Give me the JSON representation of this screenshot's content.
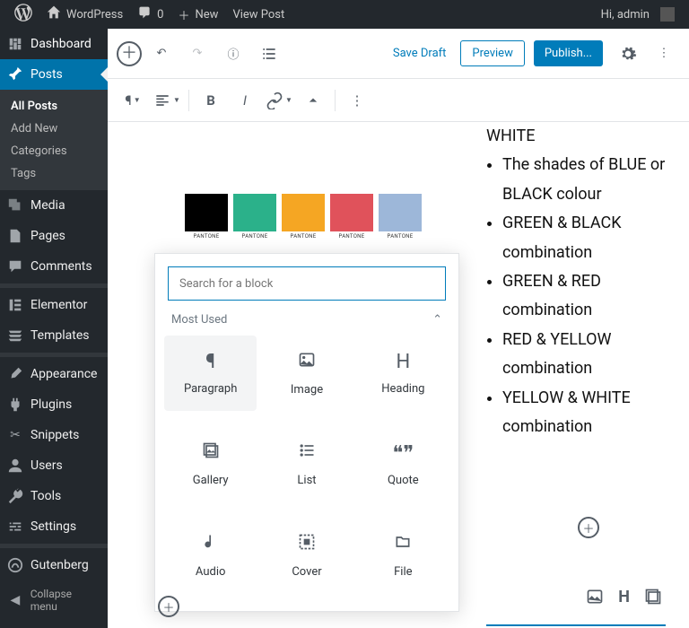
{
  "adminbar": {
    "site": "WordPress",
    "comments": "0",
    "new": "New",
    "view": "View Post",
    "greeting": "Hi, admin"
  },
  "sidebar": {
    "dashboard": "Dashboard",
    "posts": "Posts",
    "posts_sub": [
      "All Posts",
      "Add New",
      "Categories",
      "Tags"
    ],
    "media": "Media",
    "pages": "Pages",
    "comments": "Comments",
    "elementor": "Elementor",
    "templates": "Templates",
    "appearance": "Appearance",
    "plugins": "Plugins",
    "snippets": "Snippets",
    "users": "Users",
    "tools": "Tools",
    "settings": "Settings",
    "gutenberg": "Gutenberg",
    "collapse": "Collapse menu"
  },
  "editor": {
    "save_draft": "Save Draft",
    "preview": "Preview",
    "publish": "Publish..."
  },
  "swatches": [
    {
      "color": "#000000",
      "label": "PANTONE"
    },
    {
      "color": "#2bb18a",
      "label": "PANTONE"
    },
    {
      "color": "#f5a623",
      "label": "PANTONE"
    },
    {
      "color": "#e0525b",
      "label": "PANTONE"
    },
    {
      "color": "#9db7d9",
      "label": "PANTONE"
    }
  ],
  "list_items": [
    "WHITE",
    "The  shades of BLUE or BLACK colour",
    " GREEN & BLACK combination",
    " GREEN & RED combination",
    " RED & YELLOW combination",
    " YELLOW & WHITE combination"
  ],
  "inserter": {
    "placeholder": "Search for a block",
    "section": "Most Used",
    "blocks": [
      "Paragraph",
      "Image",
      "Heading",
      "Gallery",
      "List",
      "Quote",
      "Audio",
      "Cover",
      "File"
    ]
  }
}
